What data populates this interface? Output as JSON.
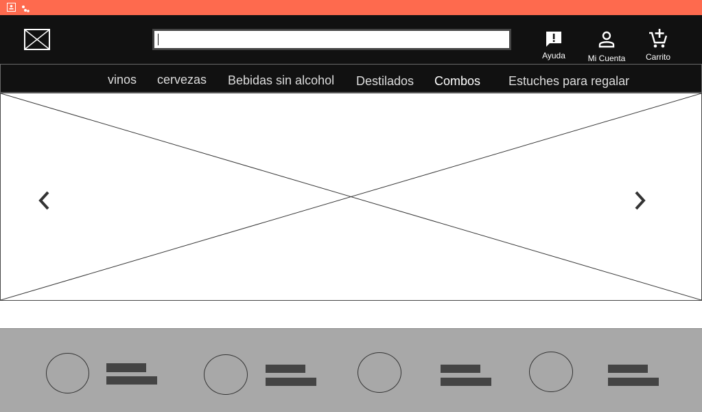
{
  "topbar": {
    "color": "#fe6a4e",
    "icons": [
      "contact-card-icon",
      "apps-icon"
    ]
  },
  "header": {
    "logo": "image-placeholder-icon",
    "search": {
      "value": "",
      "placeholder": ""
    },
    "actions": [
      {
        "label": "Ayuda",
        "icon": "feedback-icon"
      },
      {
        "label": "Mi Cuenta",
        "icon": "person-icon"
      },
      {
        "label": "Carrito",
        "icon": "add-shopping-cart-icon"
      }
    ]
  },
  "nav": {
    "items": [
      "vinos",
      "cervezas",
      "Bebidas sin alcohol",
      "Destilados",
      "Combos",
      "Estuches para regalar"
    ]
  },
  "carousel": {
    "prev_icon": "chevron-left-icon",
    "next_icon": "chevron-right-icon"
  },
  "features": {
    "count": 4,
    "background": "#a8a8a8"
  }
}
